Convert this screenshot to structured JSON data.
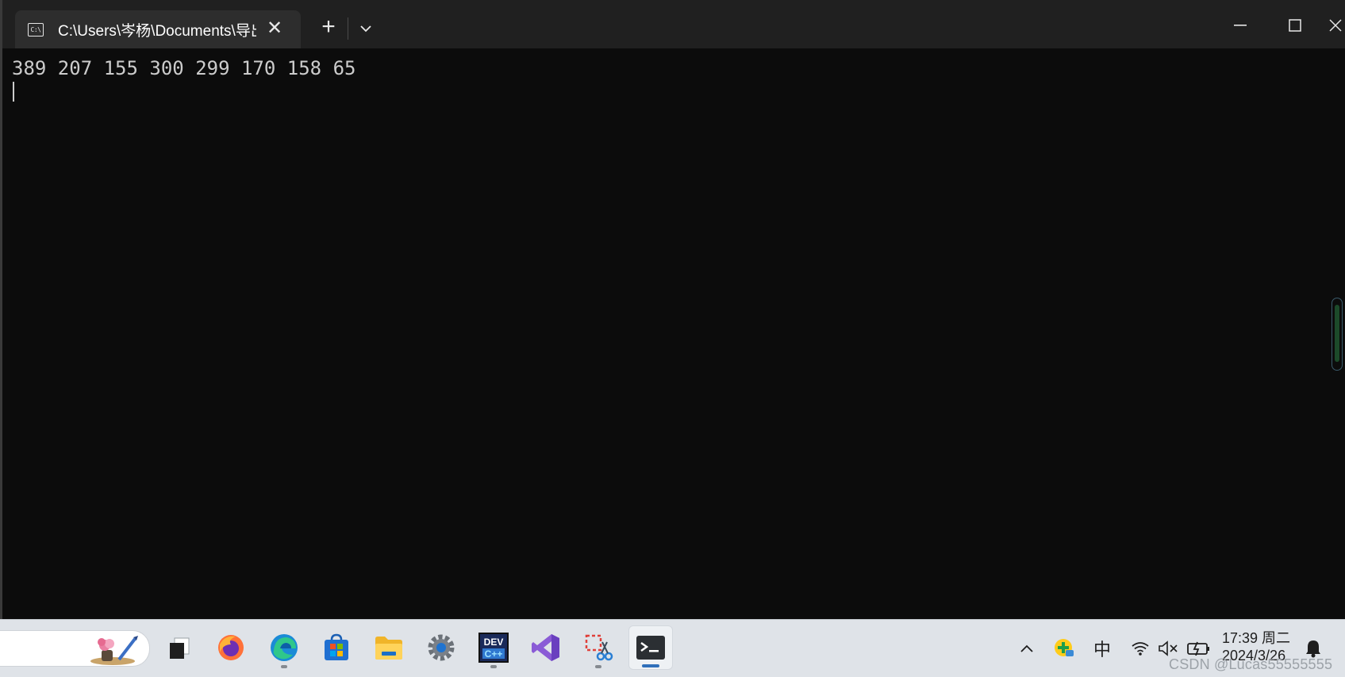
{
  "window": {
    "tab_icon_text": "C:\\",
    "tab_title": "C:\\Users\\岑杨\\Documents\\导出",
    "tab_close": "✕",
    "new_tab": "+",
    "minimize": "—",
    "maximize": "☐",
    "close": "✕"
  },
  "terminal": {
    "output_line": "389 207 155 300 299 170 158 65"
  },
  "taskbar": {
    "apps": [
      {
        "name": "task-view",
        "icon": "task-view-icon"
      },
      {
        "name": "firefox",
        "icon": "firefox-icon"
      },
      {
        "name": "edge",
        "icon": "edge-icon"
      },
      {
        "name": "store",
        "icon": "microsoft-store-icon"
      },
      {
        "name": "file-explorer",
        "icon": "folder-icon"
      },
      {
        "name": "settings",
        "icon": "gear-icon"
      },
      {
        "name": "dev-cpp",
        "icon": "dev-cpp-icon",
        "label": "DEV"
      },
      {
        "name": "visual-studio",
        "icon": "visual-studio-icon"
      },
      {
        "name": "snipping-tool",
        "icon": "snipping-tool-icon"
      },
      {
        "name": "terminal",
        "icon": "terminal-icon"
      }
    ],
    "tray": {
      "ime": "中",
      "time": "17:39 周二",
      "date": "2024/3/26"
    }
  },
  "watermark": "CSDN @Lucas55555555",
  "colors": {
    "terminal_bg": "#0c0c0c",
    "terminal_fg": "#cccccc",
    "titlebar_bg": "#202020",
    "tab_bg": "#2d2d2d",
    "taskbar_bg": "#dfe3e8",
    "accent": "#2f6fba"
  }
}
